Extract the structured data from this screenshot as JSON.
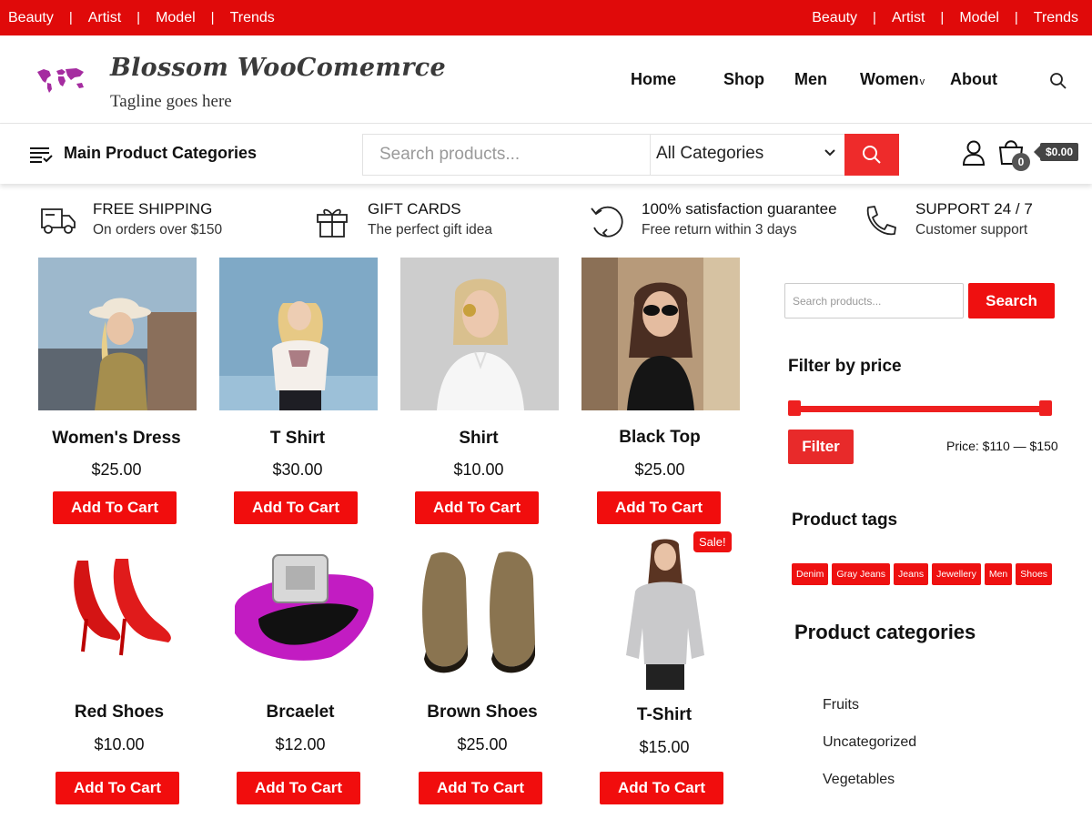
{
  "topbar": {
    "left_links": [
      "Beauty",
      "Artist",
      "Model",
      "Trends"
    ],
    "right_links": [
      "Beauty",
      "Artist",
      "Model",
      "Trends"
    ],
    "separator": "|",
    "bg_color": "#e00a0a"
  },
  "header": {
    "site_title": "Blossom WooComemrce",
    "tagline": "Tagline goes here",
    "logo_icon": "world-map-icon",
    "nav": [
      "Home",
      "Shop",
      "Men",
      "Women",
      "About"
    ],
    "nav_dropdown_marker": "v",
    "search_icon": "search-icon"
  },
  "catbar": {
    "title": "Main Product Categories",
    "search_placeholder": "Search products...",
    "category_select": "All Categories",
    "cart_count": "0",
    "cart_total": "$0.00"
  },
  "features": [
    {
      "icon": "truck-icon",
      "title": "FREE SHIPPING",
      "subtitle": "On orders over $150"
    },
    {
      "icon": "gift-icon",
      "title": "GIFT CARDS",
      "subtitle": "The perfect gift idea"
    },
    {
      "icon": "return-icon",
      "title": "100% satisfaction guarantee",
      "subtitle": "Free return within 3 days"
    },
    {
      "icon": "phone-icon",
      "title": "SUPPORT 24 / 7",
      "subtitle": "Customer support"
    }
  ],
  "products": [
    {
      "name": "Women's Dress",
      "price": "$25.00",
      "button": "Add To Cart",
      "image": "woman-in-hat-photo"
    },
    {
      "name": "T Shirt",
      "price": "$30.00",
      "button": "Add To Cart",
      "image": "woman-blouse-photo"
    },
    {
      "name": "Shirt",
      "price": "$10.00",
      "button": "Add To Cart",
      "image": "woman-white-shirt-photo"
    },
    {
      "name": "Black Top",
      "price": "$25.00",
      "button": "Add To Cart",
      "image": "woman-sunglasses-photo"
    },
    {
      "name": "Red Shoes",
      "price": "$10.00",
      "button": "Add To Cart",
      "image": "red-heels-photo"
    },
    {
      "name": "Brcaelet",
      "price": "$12.00",
      "button": "Add To Cart",
      "image": "pink-bracelet-photo"
    },
    {
      "name": "Brown Shoes",
      "price": "$25.00",
      "button": "Add To Cart",
      "image": "brown-shoes-photo"
    },
    {
      "name": "T-Shirt",
      "price": "$15.00",
      "button": "Add To Cart",
      "image": "woman-sweater-photo",
      "badge": "Sale!"
    }
  ],
  "sidebar": {
    "search_placeholder": "Search products...",
    "search_button": "Search",
    "filter_heading": "Filter by price",
    "filter_button": "Filter",
    "price_range": "Price: $110 — $150",
    "tags_heading": "Product tags",
    "tags": [
      "Denim",
      "Gray Jeans",
      "Jeans",
      "Jewellery",
      "Men",
      "Shoes"
    ],
    "categories_heading": "Product categories",
    "categories": [
      "Fruits",
      "Uncategorized",
      "Vegetables"
    ]
  },
  "colors": {
    "accent": "#ee1111",
    "dark": "#111111"
  }
}
